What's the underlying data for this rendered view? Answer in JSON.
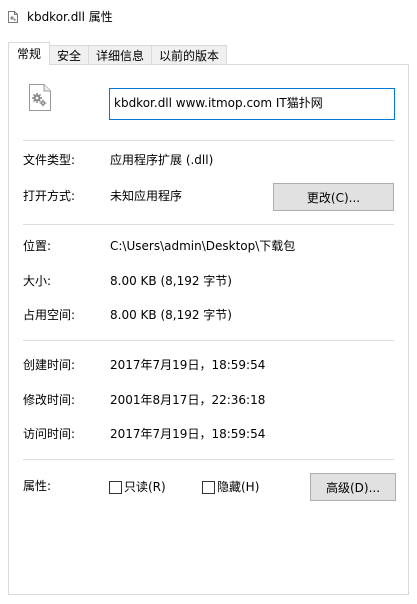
{
  "window": {
    "title": "kbdkor.dll 属性"
  },
  "tabs": [
    {
      "label": "常规",
      "active": true
    },
    {
      "label": "安全",
      "active": false
    },
    {
      "label": "详细信息",
      "active": false
    },
    {
      "label": "以前的版本",
      "active": false
    }
  ],
  "general": {
    "file_name": "kbdkor.dll www.itmop.com IT猫扑网",
    "file_type_label": "文件类型:",
    "file_type_value": "应用程序扩展 (.dll)",
    "open_with_label": "打开方式:",
    "open_with_value": "未知应用程序",
    "change_button": "更改(C)...",
    "location_label": "位置:",
    "location_value": "C:\\Users\\admin\\Desktop\\下载包",
    "size_label": "大小:",
    "size_value": "8.00 KB (8,192 字节)",
    "size_on_disk_label": "占用空间:",
    "size_on_disk_value": "8.00 KB (8,192 字节)",
    "created_label": "创建时间:",
    "created_value": "2017年7月19日，18:59:54",
    "modified_label": "修改时间:",
    "modified_value": "2001年8月17日，22:36:18",
    "accessed_label": "访问时间:",
    "accessed_value": "2017年7月19日，18:59:54",
    "attributes_label": "属性:",
    "readonly_label": "只读(R)",
    "hidden_label": "隐藏(H)",
    "advanced_button": "高级(D)..."
  },
  "icons": {
    "title_icon": "dll-file-icon",
    "file_icon": "dll-gear-file-icon"
  },
  "colors": {
    "accent": "#0078d7",
    "button_bg": "#e1e1e1",
    "button_border": "#adadad",
    "tab_border": "#d9d9d9"
  }
}
